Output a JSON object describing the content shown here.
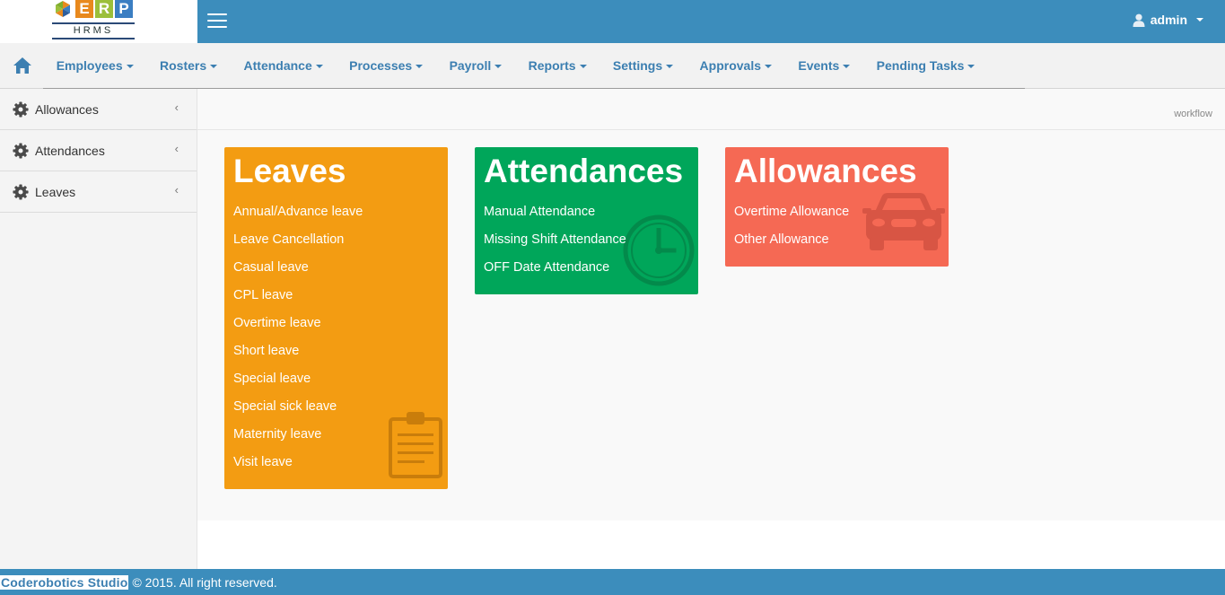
{
  "brand": {
    "logo_letters": [
      "E",
      "R",
      "P"
    ],
    "logo_subtitle": "HRMS",
    "colors": {
      "topbar": "#3c8dbc",
      "nav_text": "#3c7fb1"
    }
  },
  "header": {
    "menu_icon": "hamburger-icon",
    "user_icon": "user-icon",
    "user_name": "admin"
  },
  "nav": {
    "home_icon": "home-icon",
    "items": [
      {
        "label": "Employees"
      },
      {
        "label": "Rosters"
      },
      {
        "label": "Attendance"
      },
      {
        "label": "Processes"
      },
      {
        "label": "Payroll"
      },
      {
        "label": "Reports"
      },
      {
        "label": "Settings"
      },
      {
        "label": "Approvals"
      },
      {
        "label": "Events"
      },
      {
        "label": "Pending Tasks"
      }
    ]
  },
  "sidebar": {
    "items": [
      {
        "label": "Allowances",
        "icon": "gear-icon"
      },
      {
        "label": "Attendances",
        "icon": "gear-icon"
      },
      {
        "label": "Leaves",
        "icon": "gear-icon"
      }
    ]
  },
  "main": {
    "breadcrumb": "workflow",
    "tiles": [
      {
        "title": "Leaves",
        "color": "#f39c12",
        "icon": "clipboard-icon",
        "links": [
          "Annual/Advance leave",
          "Leave Cancellation",
          "Casual leave",
          "CPL leave",
          "Overtime leave",
          "Short leave",
          "Special leave",
          "Special sick leave",
          "Maternity leave",
          "Visit leave"
        ]
      },
      {
        "title": "Attendances",
        "color": "#00a65a",
        "icon": "clock-icon",
        "links": [
          "Manual Attendance",
          "Missing Shift Attendance",
          "OFF Date Attendance"
        ]
      },
      {
        "title": "Allowances",
        "color": "#f56954",
        "icon": "car-icon",
        "links": [
          "Overtime Allowance",
          "Other Allowance"
        ]
      }
    ]
  },
  "footer": {
    "brand": "Coderobotics Studio",
    "copyright": "© 2015. All right reserved."
  }
}
